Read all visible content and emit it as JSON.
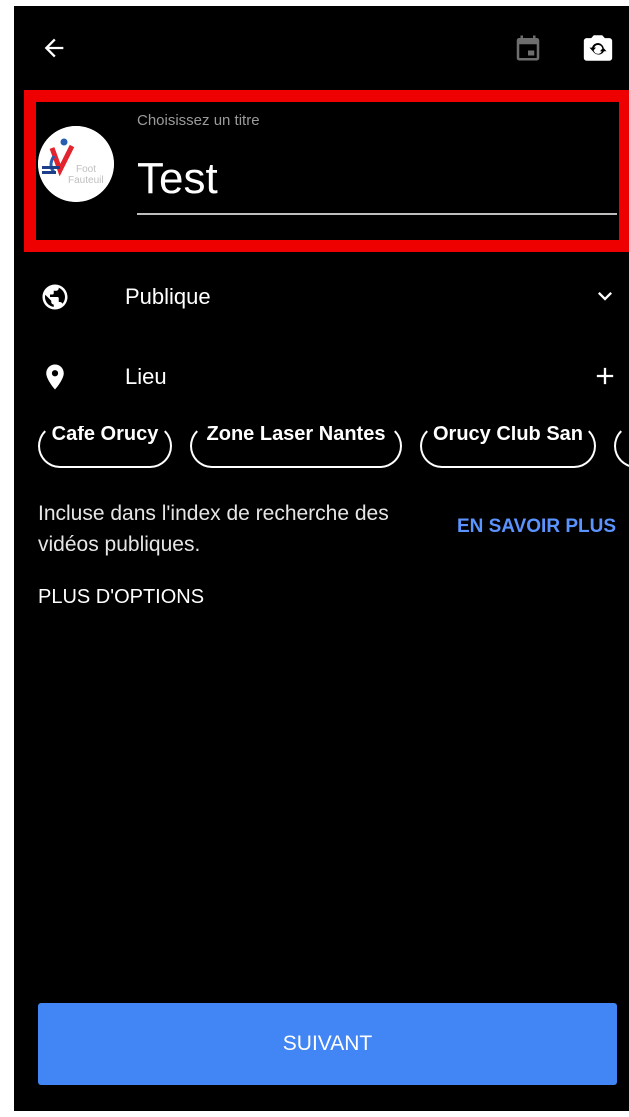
{
  "header": {
    "back_icon": "arrow-left-icon",
    "calendar_icon": "calendar-icon",
    "camera_flip_icon": "camera-flip-icon"
  },
  "title_field": {
    "label": "Choisissez un titre",
    "value": "Test",
    "avatar_text": "Foot Fauteuil"
  },
  "visibility": {
    "icon": "globe-icon",
    "label": "Publique",
    "action_icon": "chevron-down-icon"
  },
  "location": {
    "icon": "location-pin-icon",
    "label": "Lieu",
    "action_icon": "plus-icon"
  },
  "location_suggestions": [
    "Cafe Orucy",
    "Zone Laser Nantes",
    "Orucy Club San"
  ],
  "index_notice": {
    "text": "Incluse dans l'index de recherche des vidéos publiques.",
    "learn_more": "EN SAVOIR PLUS"
  },
  "more_options": "PLUS D'OPTIONS",
  "next_button": "SUIVANT",
  "colors": {
    "background": "#000000",
    "accent": "#4285f4",
    "link": "#5b93ff",
    "highlight": "#ee0000"
  }
}
